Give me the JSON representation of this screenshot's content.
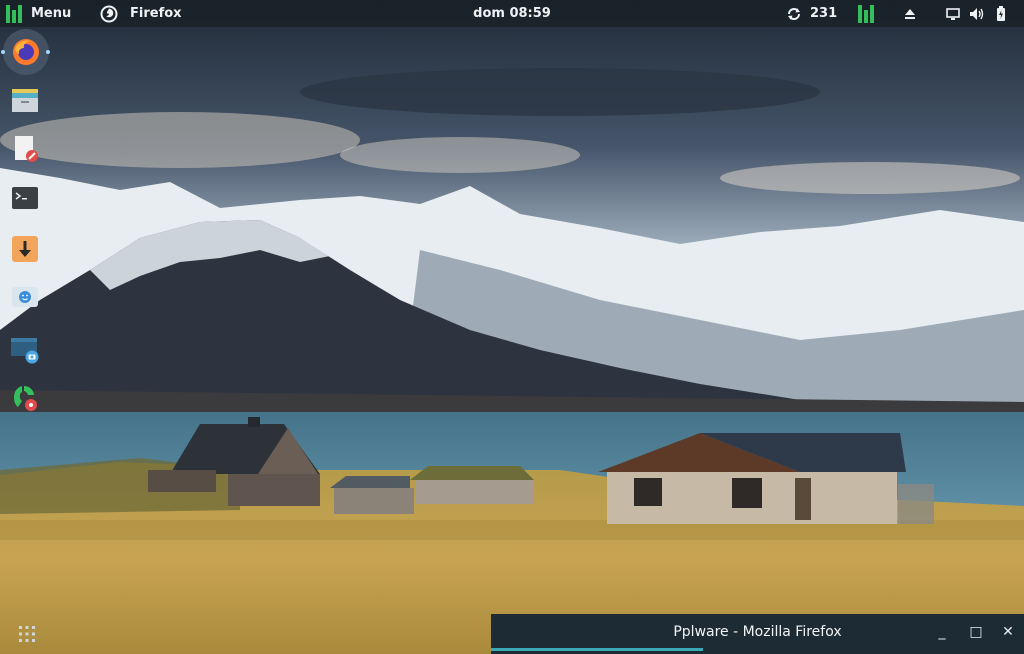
{
  "panel": {
    "menu_label": "Menu",
    "task_label": "Firefox",
    "clock": "dom 08:59",
    "updates_count": "231"
  },
  "icons": {
    "menu": "manjaro-logo-icon",
    "firefox": "firefox-icon",
    "updates": "update-sync-icon",
    "eject": "eject-icon",
    "screen": "display-icon",
    "volume": "speaker-icon",
    "battery": "battery-icon"
  },
  "dock": {
    "items": [
      "firefox",
      "file-manager",
      "text-editor",
      "terminal",
      "downloader",
      "software-center",
      "screenshot",
      "settings-manager"
    ]
  },
  "window": {
    "title": "Pplware - Mozilla Firefox",
    "minimize": "_",
    "maximize": "□",
    "close": "✕"
  },
  "colors": {
    "accent": "#35bf5c",
    "panel": "#181e24",
    "taskbar": "#1d2c34",
    "progress": "#3aa8b7"
  }
}
